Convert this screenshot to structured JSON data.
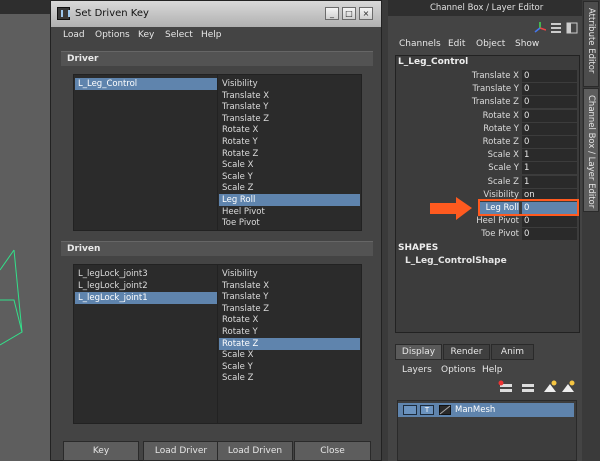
{
  "dialog": {
    "title": "Set Driven Key",
    "menu": [
      "Load",
      "Options",
      "Key",
      "Select",
      "Help"
    ],
    "driver_header": "Driver",
    "driven_header": "Driven",
    "driver_objects": [
      "L_Leg_Control"
    ],
    "driver_attributes": [
      "Visibility",
      "Translate X",
      "Translate Y",
      "Translate Z",
      "Rotate X",
      "Rotate Y",
      "Rotate Z",
      "Scale X",
      "Scale Y",
      "Scale Z",
      "Leg Roll",
      "Heel Pivot",
      "Toe Pivot"
    ],
    "driven_objects": [
      "L_legLock_joint3",
      "L_legLock_joint2",
      "L_legLock_joint1"
    ],
    "driven_attributes": [
      "Visibility",
      "Translate X",
      "Translate Y",
      "Translate Z",
      "Rotate X",
      "Rotate Y",
      "Rotate Z",
      "Scale X",
      "Scale Y",
      "Scale Z"
    ],
    "buttons": [
      "Key",
      "Load Driver",
      "Load Driven",
      "Close"
    ],
    "min_icon": "_",
    "max_icon": "□",
    "close_icon": "×"
  },
  "channel_box": {
    "title": "Channel Box / Layer Editor",
    "menu": [
      "Channels",
      "Edit",
      "Object",
      "Show"
    ],
    "node": "L_Leg_Control",
    "attributes": [
      {
        "label": "Translate X",
        "value": "0"
      },
      {
        "label": "Translate Y",
        "value": "0"
      },
      {
        "label": "Translate Z",
        "value": "0"
      },
      {
        "label": "Rotate X",
        "value": "0"
      },
      {
        "label": "Rotate Y",
        "value": "0"
      },
      {
        "label": "Rotate Z",
        "value": "0"
      },
      {
        "label": "Scale X",
        "value": "1"
      },
      {
        "label": "Scale Y",
        "value": "1"
      },
      {
        "label": "Scale Z",
        "value": "1"
      },
      {
        "label": "Visibility",
        "value": "on"
      },
      {
        "label": "Leg Roll",
        "value": "0"
      },
      {
        "label": "Heel Pivot",
        "value": "0"
      },
      {
        "label": "Toe Pivot",
        "value": "0"
      }
    ],
    "shapes_header": "SHAPES",
    "shape_name": "L_Leg_ControlShape"
  },
  "side_tabs": [
    "Attribute Editor",
    "Channel Box / Layer Editor"
  ],
  "layer_editor": {
    "tabs": [
      "Display",
      "Render",
      "Anim"
    ],
    "menu": [
      "Layers",
      "Options",
      "Help"
    ],
    "layer": {
      "visible": "",
      "type": "T",
      "name": "ManMesh"
    }
  },
  "colors": {
    "selection": "#5f84ad",
    "highlight_arrow": "#ff5a1f"
  }
}
